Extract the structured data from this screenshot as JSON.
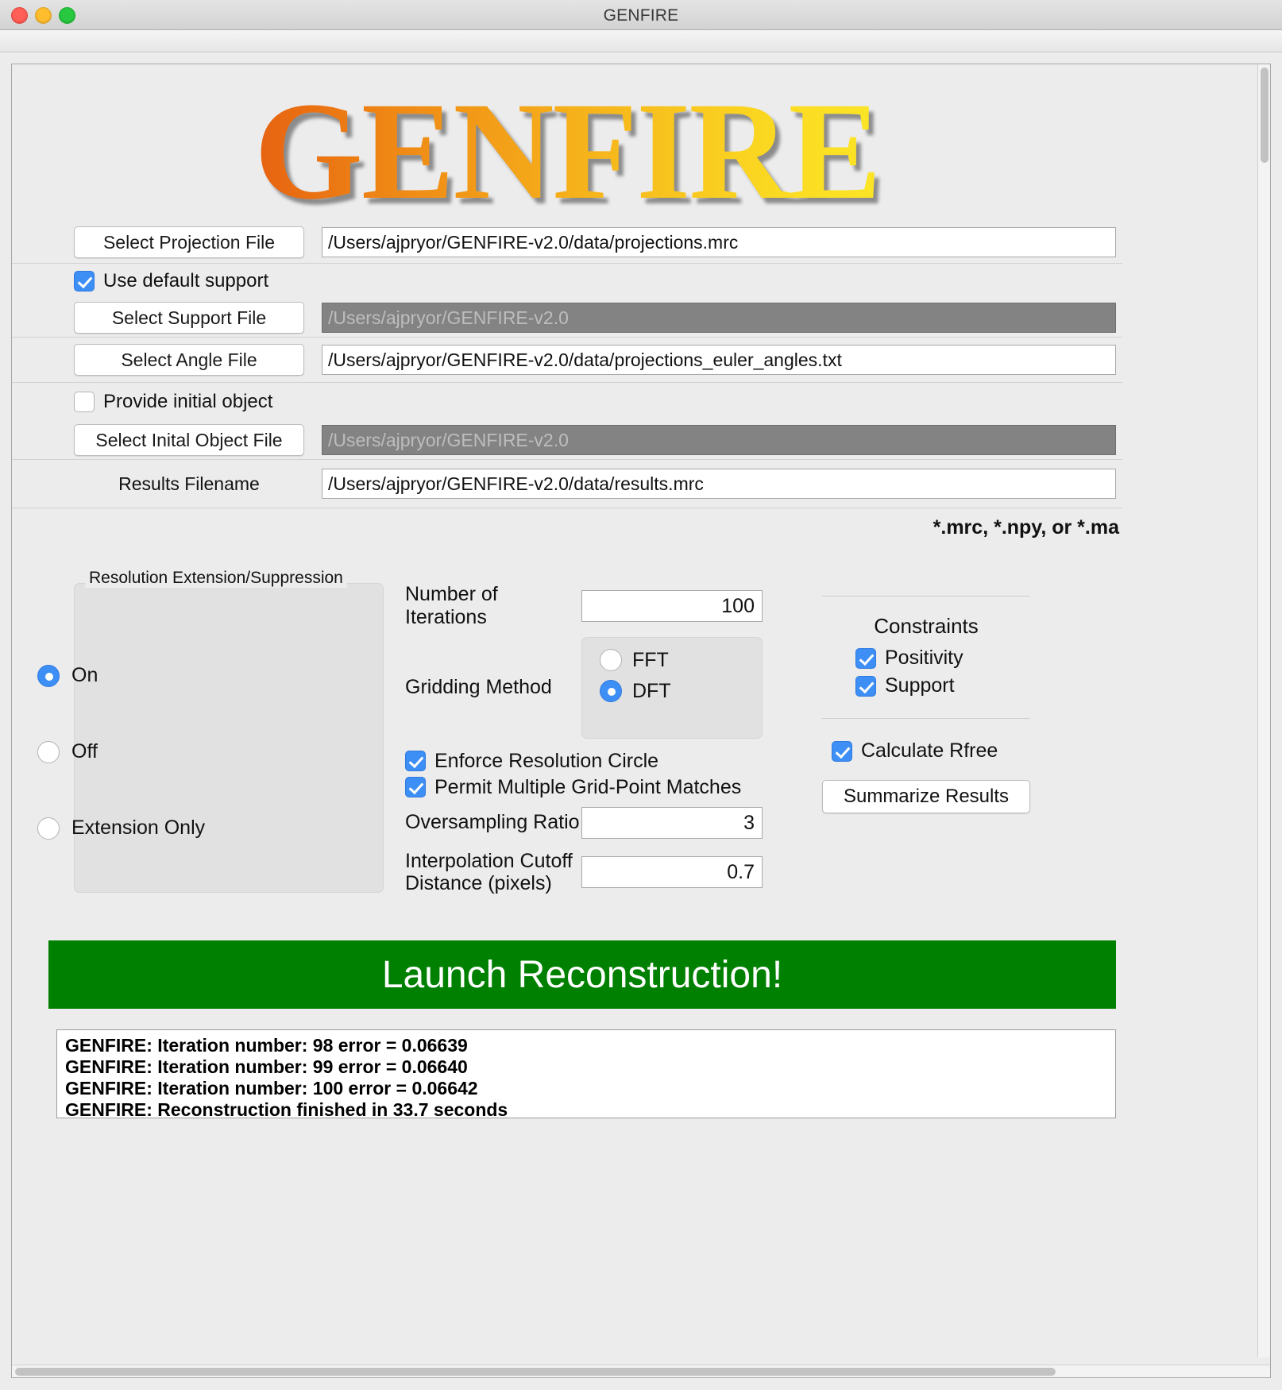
{
  "window": {
    "title": "GENFIRE",
    "traffic_lights": [
      "close-button",
      "minimize-button",
      "maximize-button"
    ]
  },
  "logo": {
    "text": "GENFIRE"
  },
  "files": {
    "projection": {
      "button": "Select Projection File",
      "value": "/Users/ajpryor/GENFIRE-v2.0/data/projections.mrc",
      "disabled": false
    },
    "use_default_support": {
      "label": "Use default support",
      "checked": true
    },
    "support": {
      "button": "Select Support File",
      "value": "/Users/ajpryor/GENFIRE-v2.0",
      "disabled": true
    },
    "angle": {
      "button": "Select Angle File",
      "value": "/Users/ajpryor/GENFIRE-v2.0/data/projections_euler_angles.txt",
      "disabled": false
    },
    "provide_initial_object": {
      "label": "Provide initial object",
      "checked": false
    },
    "initial_object": {
      "button": "Select Inital Object File",
      "value": "/Users/ajpryor/GENFIRE-v2.0",
      "disabled": true
    },
    "results": {
      "label": "Results Filename",
      "value": "/Users/ajpryor/GENFIRE-v2.0/data/results.mrc"
    },
    "format_hint": "*.mrc, *.npy, or *.ma"
  },
  "resolution_group": {
    "title": "Resolution Extension/Suppression",
    "options": [
      {
        "label": "On",
        "selected": true
      },
      {
        "label": "Off",
        "selected": false
      },
      {
        "label": "Extension Only",
        "selected": false
      }
    ]
  },
  "parameters": {
    "iterations": {
      "label": "Number of Iterations",
      "value": "100"
    },
    "gridding": {
      "label": "Gridding Method",
      "options": [
        {
          "label": "FFT",
          "selected": false
        },
        {
          "label": "DFT",
          "selected": true
        }
      ]
    },
    "enforce_resolution_circle": {
      "label": "Enforce Resolution Circle",
      "checked": true
    },
    "permit_multiple_matches": {
      "label": "Permit Multiple Grid-Point Matches",
      "checked": true
    },
    "oversampling": {
      "label": "Oversampling Ratio",
      "value": "3"
    },
    "interpolation_cutoff": {
      "label": "Interpolation Cutoff\nDistance (pixels)",
      "label_line1": "Interpolation Cutoff",
      "label_line2": "Distance (pixels)",
      "value": "0.7"
    }
  },
  "constraints": {
    "title": "Constraints",
    "items": [
      {
        "label": "Positivity",
        "checked": true
      },
      {
        "label": "Support",
        "checked": true
      }
    ],
    "calculate_rfree": {
      "label": "Calculate Rfree",
      "checked": true
    },
    "summarize_button": "Summarize Results"
  },
  "launch": {
    "label": "Launch Reconstruction!",
    "color": "#008000"
  },
  "console": {
    "lines": [
      "GENFIRE: Iteration number: 98 error = 0.06639",
      "GENFIRE: Iteration number: 99 error = 0.06640",
      "GENFIRE: Iteration number: 100 error = 0.06642",
      "GENFIRE: Reconstruction finished in 33.7 seconds"
    ]
  }
}
